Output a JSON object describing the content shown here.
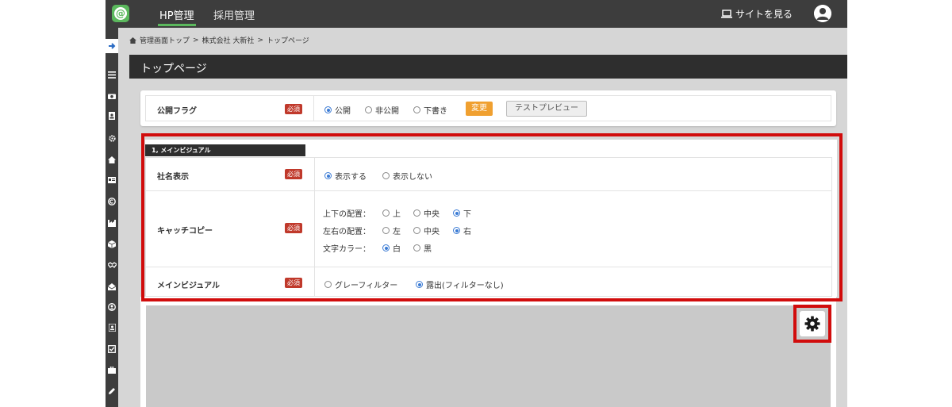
{
  "header": {
    "logo_text": "@",
    "nav_hp": "HP管理",
    "nav_recruit": "採用管理",
    "site_link": "サイトを見る"
  },
  "breadcrumb": {
    "home": "管理画面トップ",
    "sep1": ">",
    "company": "株式会社 大新社",
    "sep2": ">",
    "current": "トップページ"
  },
  "page": {
    "title": "トップページ"
  },
  "publish": {
    "label": "公開フラグ",
    "required": "必須",
    "options": [
      "公開",
      "非公開",
      "下書き"
    ],
    "selected": "公開",
    "change_button": "変更",
    "preview_button": "テストプレビュー"
  },
  "section": {
    "title": "1, メインビジュアル",
    "company_name": {
      "label": "社名表示",
      "required": "必須",
      "options": [
        "表示する",
        "表示しない"
      ],
      "selected": "表示する"
    },
    "catchcopy": {
      "label": "キャッチコピー",
      "required": "必須",
      "vertical_label": "上下の配置：",
      "vertical_options": [
        "上",
        "中央",
        "下"
      ],
      "vertical_selected": "下",
      "horizontal_label": "左右の配置：",
      "horizontal_options": [
        "左",
        "中央",
        "右"
      ],
      "horizontal_selected": "右",
      "color_label": "文字カラー：",
      "color_options": [
        "白",
        "黒"
      ],
      "color_selected": "白"
    },
    "main_visual": {
      "label": "メインビジュアル",
      "required": "必須",
      "options": [
        "グレーフィルター",
        "露出(フィルターなし)"
      ],
      "selected": "露出(フィルターなし)"
    }
  },
  "colors": {
    "topbar": "#3d3d3d",
    "accent_green": "#5bb85d",
    "required_red": "#c0392b",
    "change_orange": "#f0a030",
    "highlight_red": "#d10c0c",
    "radio_blue": "#3b7bd4"
  },
  "icons": {
    "sidebar": [
      "arrow-right-icon",
      "menu-icon",
      "camera-icon",
      "profile-card-icon",
      "gear-icon",
      "home-icon",
      "id-card-icon",
      "copyright-icon",
      "factory-icon",
      "cube-icon",
      "handshake-icon",
      "envelope-open-icon",
      "user-circle-icon",
      "user-badge-icon",
      "checkbox-icon",
      "briefcase-icon",
      "pencil-icon"
    ],
    "settings": "gear-icon"
  }
}
